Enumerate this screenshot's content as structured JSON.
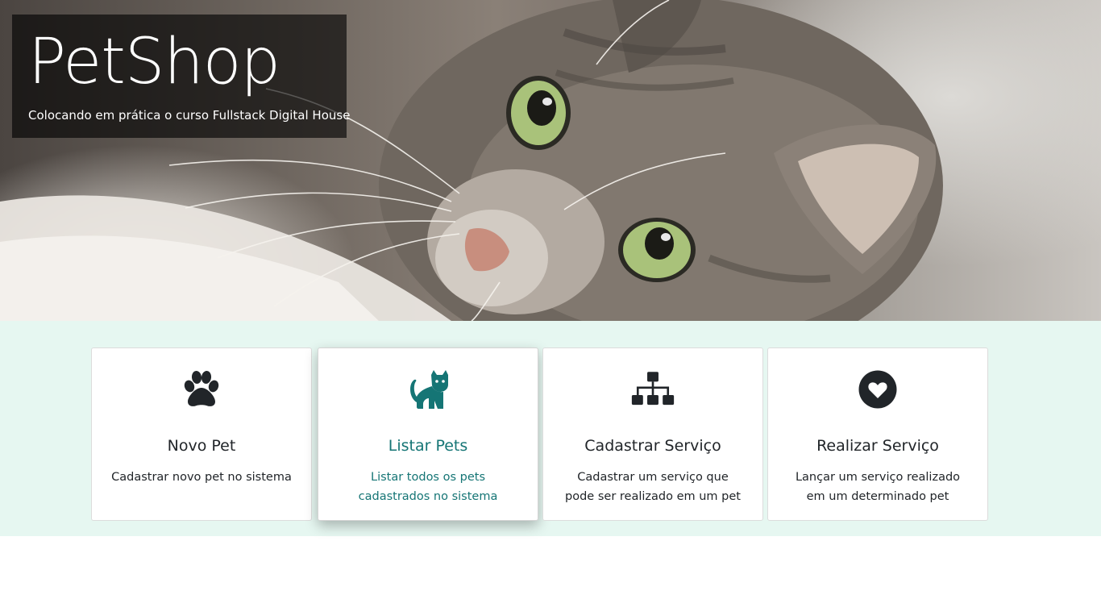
{
  "hero": {
    "title": "PetShop",
    "subtitle": "Colocando em prática o curso Fullstack Digital House"
  },
  "colors": {
    "section_background": "#e6f7f1",
    "active_accent": "#157575",
    "icon_default": "#212529"
  },
  "cards": [
    {
      "icon": "paw-icon",
      "title": "Novo Pet",
      "description": "Cadastrar novo pet no sistema"
    },
    {
      "icon": "cat-icon",
      "title": "Listar Pets",
      "description": "Listar todos os pets cadastrados no sistema",
      "active": true
    },
    {
      "icon": "sitemap-icon",
      "title": "Cadastrar Serviço",
      "description": "Cadastrar um serviço que pode ser realizado em um pet"
    },
    {
      "icon": "heart-circle-icon",
      "title": "Realizar Serviço",
      "description": "Lançar um serviço realizado em um determinado pet"
    }
  ]
}
